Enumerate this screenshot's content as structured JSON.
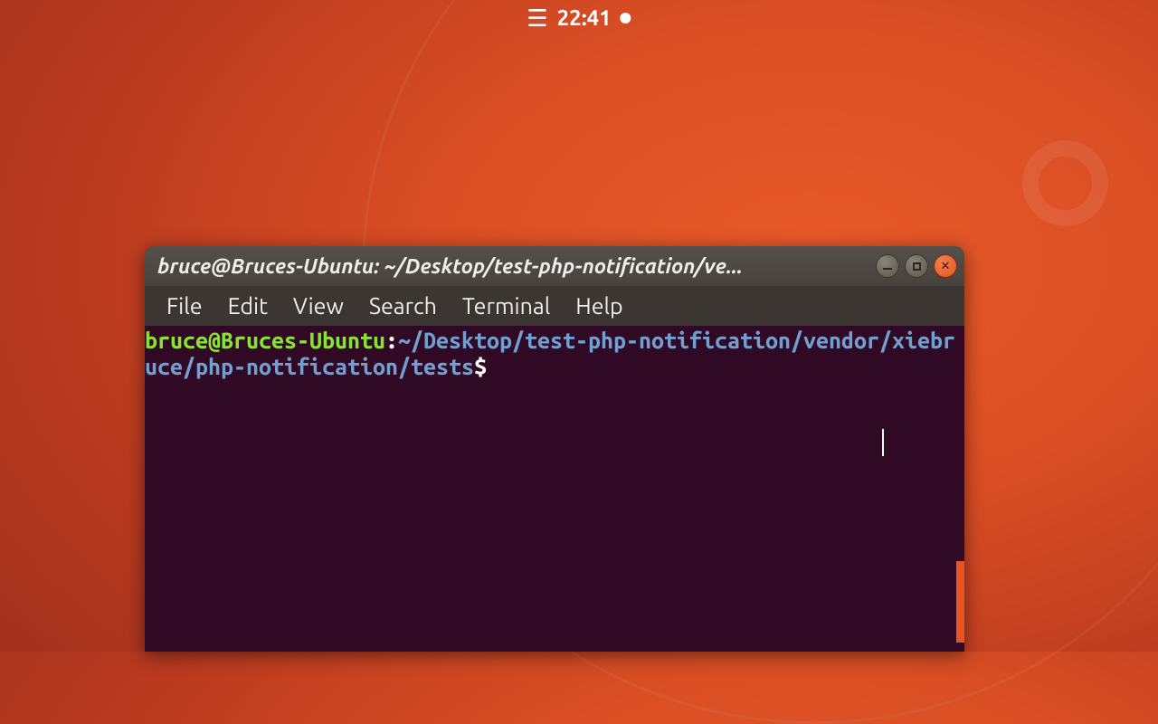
{
  "panel": {
    "clock": "22:41"
  },
  "window": {
    "title": "bruce@Bruces-Ubuntu: ~/Desktop/test-php-notification/ve..."
  },
  "menubar": {
    "items": [
      "File",
      "Edit",
      "View",
      "Search",
      "Terminal",
      "Help"
    ]
  },
  "prompt": {
    "user_host": "bruce@Bruces-Ubuntu",
    "separator": ":",
    "path": "~/Desktop/test-php-notification/vendor/xiebruce/php-notification/tests",
    "symbol": "$"
  },
  "colors": {
    "terminal_bg": "#300a24",
    "prompt_user": "#8ae234",
    "prompt_path": "#729fcf",
    "accent": "#e95420"
  }
}
